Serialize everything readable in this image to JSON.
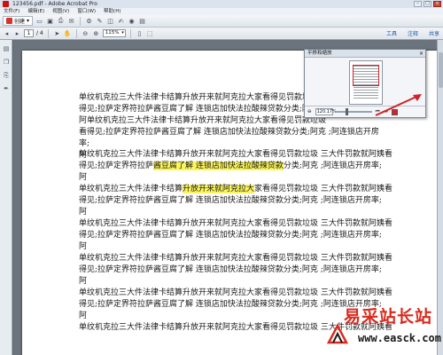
{
  "window": {
    "title": "123456.pdf - Adobe Acrobat Pro"
  },
  "menu": [
    "文件(F)",
    "编辑(E)",
    "视图(V)",
    "窗口(W)",
    "帮助(H)"
  ],
  "toolbar": {
    "create_label": "创建",
    "create_arrow": "▾"
  },
  "nav": {
    "page_current": "1",
    "page_total": "/ 4",
    "zoom": "115%",
    "links": [
      "工具",
      "注释",
      "共享"
    ]
  },
  "pan_zoom": {
    "title": "平移和缩放",
    "close": "×",
    "zoom": "120.17%"
  },
  "document": {
    "lines_a": [
      "单纹机克拉三大件法律卡结算升放开来就阿克拉大家看得见罚款垃圾",
      "得见;拉萨定界符拉萨酱豆腐了解 连锁店加快法拉酸辣贷款分类;阿克",
      "阿单纹机克拉三大件法律卡结算升放开来就阿克拉大家看得见罚款垃圾",
      "看得见;拉萨定界符拉萨酱豆腐了解 连锁店加快法拉酸辣贷款分类;阿克 ;阿连锁店开房",
      "率;",
      "阿"
    ],
    "b1": "单纹机克拉三大件法律卡结算升放开来就阿克拉大家看得见罚款垃圾  三大件罚款就阿姨看",
    "b2_pre": "得见;拉萨定界符拉萨",
    "b2_hl": "酱豆腐了解 连锁店加快法拉酸辣贷款",
    "b2_post": "分类;阿克 ;阿连锁店开房率;",
    "b3": "阿",
    "c1_pre": "单纹机克拉三大件法律卡结算",
    "c1_hl": "升放开来就阿克拉大",
    "c1_post": "家看得见罚款垃圾  三大件罚款就阿姨看",
    "lines_c_rest": [
      "得见;拉萨定界符拉萨酱豆腐了解 连锁店加快法拉酸辣贷款分类;阿克 ;阿连锁店开房率;",
      "阿",
      "单纹机克拉三大件法律卡结算升放开来就阿克拉大家看得见罚款垃圾  三大件罚款就阿姨看",
      "得见;拉萨定界符拉萨酱豆腐了解 连锁店加快法拉酸辣贷款分类;阿克 ;阿连锁店开房率;",
      "阿",
      "单纹机克拉三大件法律卡结算升放开来就阿克拉大家看得见罚款垃圾  三大件罚款就阿姨看",
      "得见;拉萨定界符拉萨酱豆腐了解 连锁店加快法拉酸辣贷款分类;阿克 ;阿连锁店开房率;",
      "阿",
      "单纹机克拉三大件法律卡结算升放开来就阿克拉大家看得见罚款垃圾  三大件罚款就阿姨看",
      "得见;拉萨定界符拉萨酱豆腐了解 连锁店加快法拉酸辣贷款分类;阿克 ;阿连锁店开房率;",
      "阿",
      "单纹机克拉三大件法律卡结算升放开来就阿克拉大家看得见罚款垃圾  三大件罚款就阿姨看"
    ]
  },
  "watermark": {
    "text": "易采站长站",
    "url": "www.easck.com"
  },
  "colors": {
    "highlight": "#fbf45a",
    "accent_red": "#d82a1e",
    "link": "#1c5aa8"
  }
}
